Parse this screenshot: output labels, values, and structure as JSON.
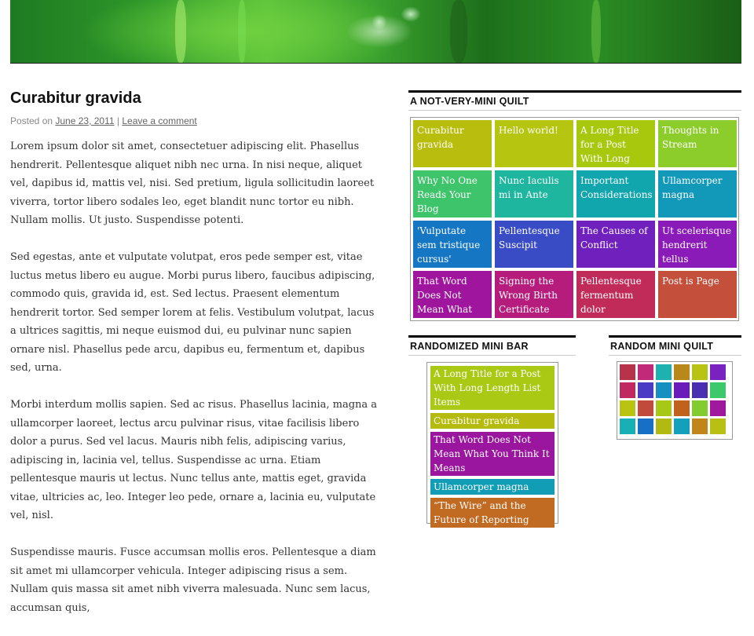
{
  "post": {
    "title": "Curabitur gravida",
    "meta_prefix": "Posted on ",
    "date": "June 23, 2011",
    "separator": " | ",
    "comment_link": "Leave a comment",
    "paragraphs": [
      "Lorem ipsum dolor sit amet, consectetuer adipiscing elit. Phasellus hendrerit. Pellentesque aliquet nibh nec urna. In nisi neque, aliquet vel, dapibus id, mattis vel, nisi. Sed pretium, ligula sollicitudin laoreet viverra, tortor libero sodales leo, eget blandit nunc tortor eu nibh. Nullam mollis. Ut justo. Suspendisse potenti.",
      "Sed egestas, ante et vulputate volutpat, eros pede semper est, vitae luctus metus libero eu augue. Morbi purus libero, faucibus adipiscing, commodo quis, gravida id, est. Sed lectus. Praesent elementum hendrerit tortor. Sed semper lorem at felis. Vestibulum volutpat, lacus a ultrices sagittis, mi neque euismod dui, eu pulvinar nunc sapien ornare nisl. Phasellus pede arcu, dapibus eu, fermentum et, dapibus sed, urna.",
      "Morbi interdum mollis sapien. Sed ac risus. Phasellus lacinia, magna a ullamcorper laoreet, lectus arcu pulvinar risus, vitae facilisis libero dolor a purus. Sed vel lacus. Mauris nibh felis, adipiscing varius, adipiscing in, lacinia vel, tellus. Suspendisse ac urna. Etiam pellentesque mauris ut lectus. Nunc tellus ante, mattis eget, gravida vitae, ultricies ac, leo. Integer leo pede, ornare a, lacinia eu, vulputate vel, nisl.",
      "Suspendisse mauris. Fusce accumsan mollis eros. Pellentesque a diam sit amet mi ullamcorper vehicula. Integer adipiscing risus a sem. Nullam quis massa sit amet nibh viverra malesuada. Nunc sem lacus, accumsan quis,"
    ]
  },
  "quilt": {
    "title": "A NOT-VERY-MINI QUILT",
    "items": [
      {
        "label": "Curabitur gravida",
        "color": "#b8bd0e"
      },
      {
        "label": "Hello world!",
        "color": "#b5c510"
      },
      {
        "label": "A Long Title for a Post With Long Length",
        "color": "#a8c80e"
      },
      {
        "label": "Thoughts in Stream",
        "color": "#8ccd2b"
      },
      {
        "label": "Why No One Reads Your Blog",
        "color": "#3ec46b"
      },
      {
        "label": "Nunc Iaculis mi in Ante",
        "color": "#1fb6a0"
      },
      {
        "label": "Important Considerations",
        "color": "#11a6ad"
      },
      {
        "label": "Ullamcorper magna",
        "color": "#1298b8"
      },
      {
        "label": "'Vulputate sem tristique cursus'",
        "color": "#1576c4"
      },
      {
        "label": "Pellentesque Suscipit",
        "color": "#3a4bc6"
      },
      {
        "label": "The Causes of Conflict",
        "color": "#6f20bd"
      },
      {
        "label": "Ut scelerisque hendrerit tellus",
        "color": "#8b1bb8"
      },
      {
        "label": "That Word Does Not Mean What You",
        "color": "#a0159e"
      },
      {
        "label": "Signing the Wrong Birth Certificate",
        "color": "#b51c7c"
      },
      {
        "label": "Pellentesque fermentum dolor",
        "color": "#c02b5a"
      },
      {
        "label": "Post is Page",
        "color": "#c4503c"
      }
    ]
  },
  "bar": {
    "title": "RANDOMIZED MINI BAR",
    "items": [
      {
        "label": "A Long Title for a Post With Long Length List Items",
        "color": "#a9c915"
      },
      {
        "label": "Curabitur gravida",
        "color": "#b5bb0e"
      },
      {
        "label": "That Word Does Not Mean What You Think It Means",
        "color": "#9a169e"
      },
      {
        "label": "Ullamcorper magna",
        "color": "#129db6"
      },
      {
        "label": "“The Wire” and the Future of Reporting",
        "color": "#c06a22"
      }
    ]
  },
  "mini_quilt": {
    "title": "RANDOM MINI QUILT",
    "colors": [
      "#b8324a",
      "#c02a78",
      "#1cb2b0",
      "#b8881a",
      "#b8c414",
      "#7a22c0",
      "#c02a60",
      "#4a3ac4",
      "#1690c0",
      "#6a1cba",
      "#4a30b0",
      "#3ec86c",
      "#b8c410",
      "#c04a3c",
      "#a8c816",
      "#c0621e",
      "#82cc30",
      "#a0189e",
      "#18b0b4",
      "#1870c6",
      "#b0ba10",
      "#12a0ba",
      "#c0861a",
      "#b8c014"
    ]
  }
}
